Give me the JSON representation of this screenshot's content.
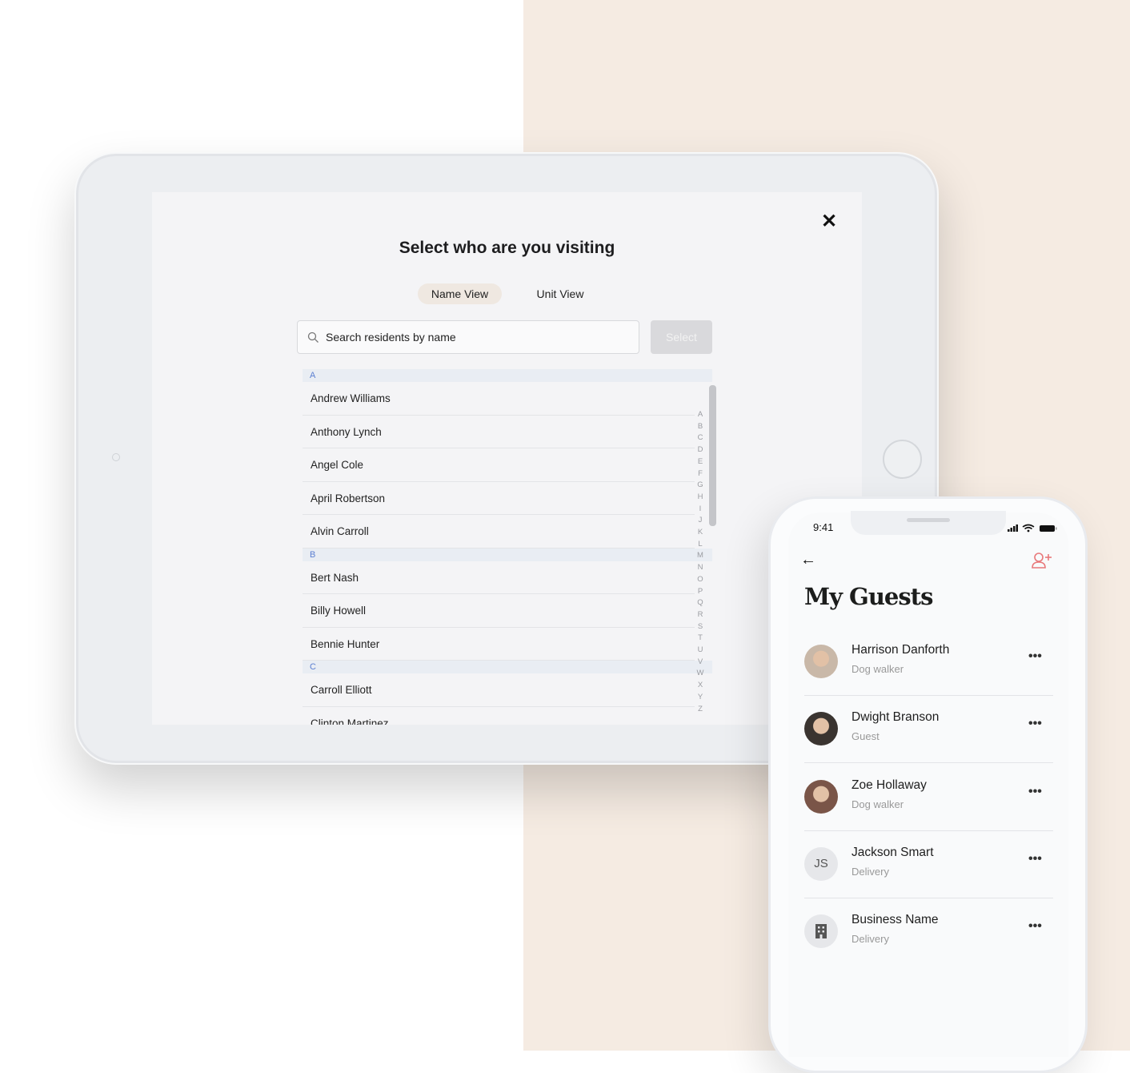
{
  "tablet": {
    "close_icon": "close-icon",
    "title": "Select who are you visiting",
    "tabs": [
      {
        "label": "Name View",
        "active": true
      },
      {
        "label": "Unit View",
        "active": false
      }
    ],
    "search_placeholder": "Search residents by name",
    "select_label": "Select",
    "sections": [
      {
        "letter": "A",
        "names": [
          "Andrew Williams",
          "Anthony Lynch",
          "Angel Cole",
          "April Robertson",
          "Alvin Carroll"
        ]
      },
      {
        "letter": "B",
        "names": [
          "Bert Nash",
          "Billy Howell",
          "Bennie Hunter"
        ]
      },
      {
        "letter": "C",
        "names": [
          "Carroll Elliott",
          "Clinton Martinez"
        ]
      }
    ],
    "alphabet": [
      "A",
      "B",
      "C",
      "D",
      "E",
      "F",
      "G",
      "H",
      "I",
      "J",
      "K",
      "L",
      "M",
      "N",
      "O",
      "P",
      "Q",
      "R",
      "S",
      "T",
      "U",
      "V",
      "W",
      "X",
      "Y",
      "Z"
    ],
    "accent": "#5b7fd1"
  },
  "phone": {
    "time": "9:41",
    "status_icons": [
      "signal-icon",
      "wifi-icon",
      "battery-icon"
    ],
    "title": "My Guests",
    "accent": "#e8787a",
    "guests": [
      {
        "name": "Harrison Danforth",
        "role": "Dog walker",
        "avatar": "photo"
      },
      {
        "name": "Dwight Branson",
        "role": "Guest",
        "avatar": "photo"
      },
      {
        "name": "Zoe Hollaway",
        "role": "Dog walker",
        "avatar": "photo"
      },
      {
        "name": "Jackson Smart",
        "role": "Delivery",
        "avatar": "initials",
        "initials": "JS"
      },
      {
        "name": "Business Name",
        "role": "Delivery",
        "avatar": "building-icon"
      }
    ],
    "more_label": "•••"
  }
}
